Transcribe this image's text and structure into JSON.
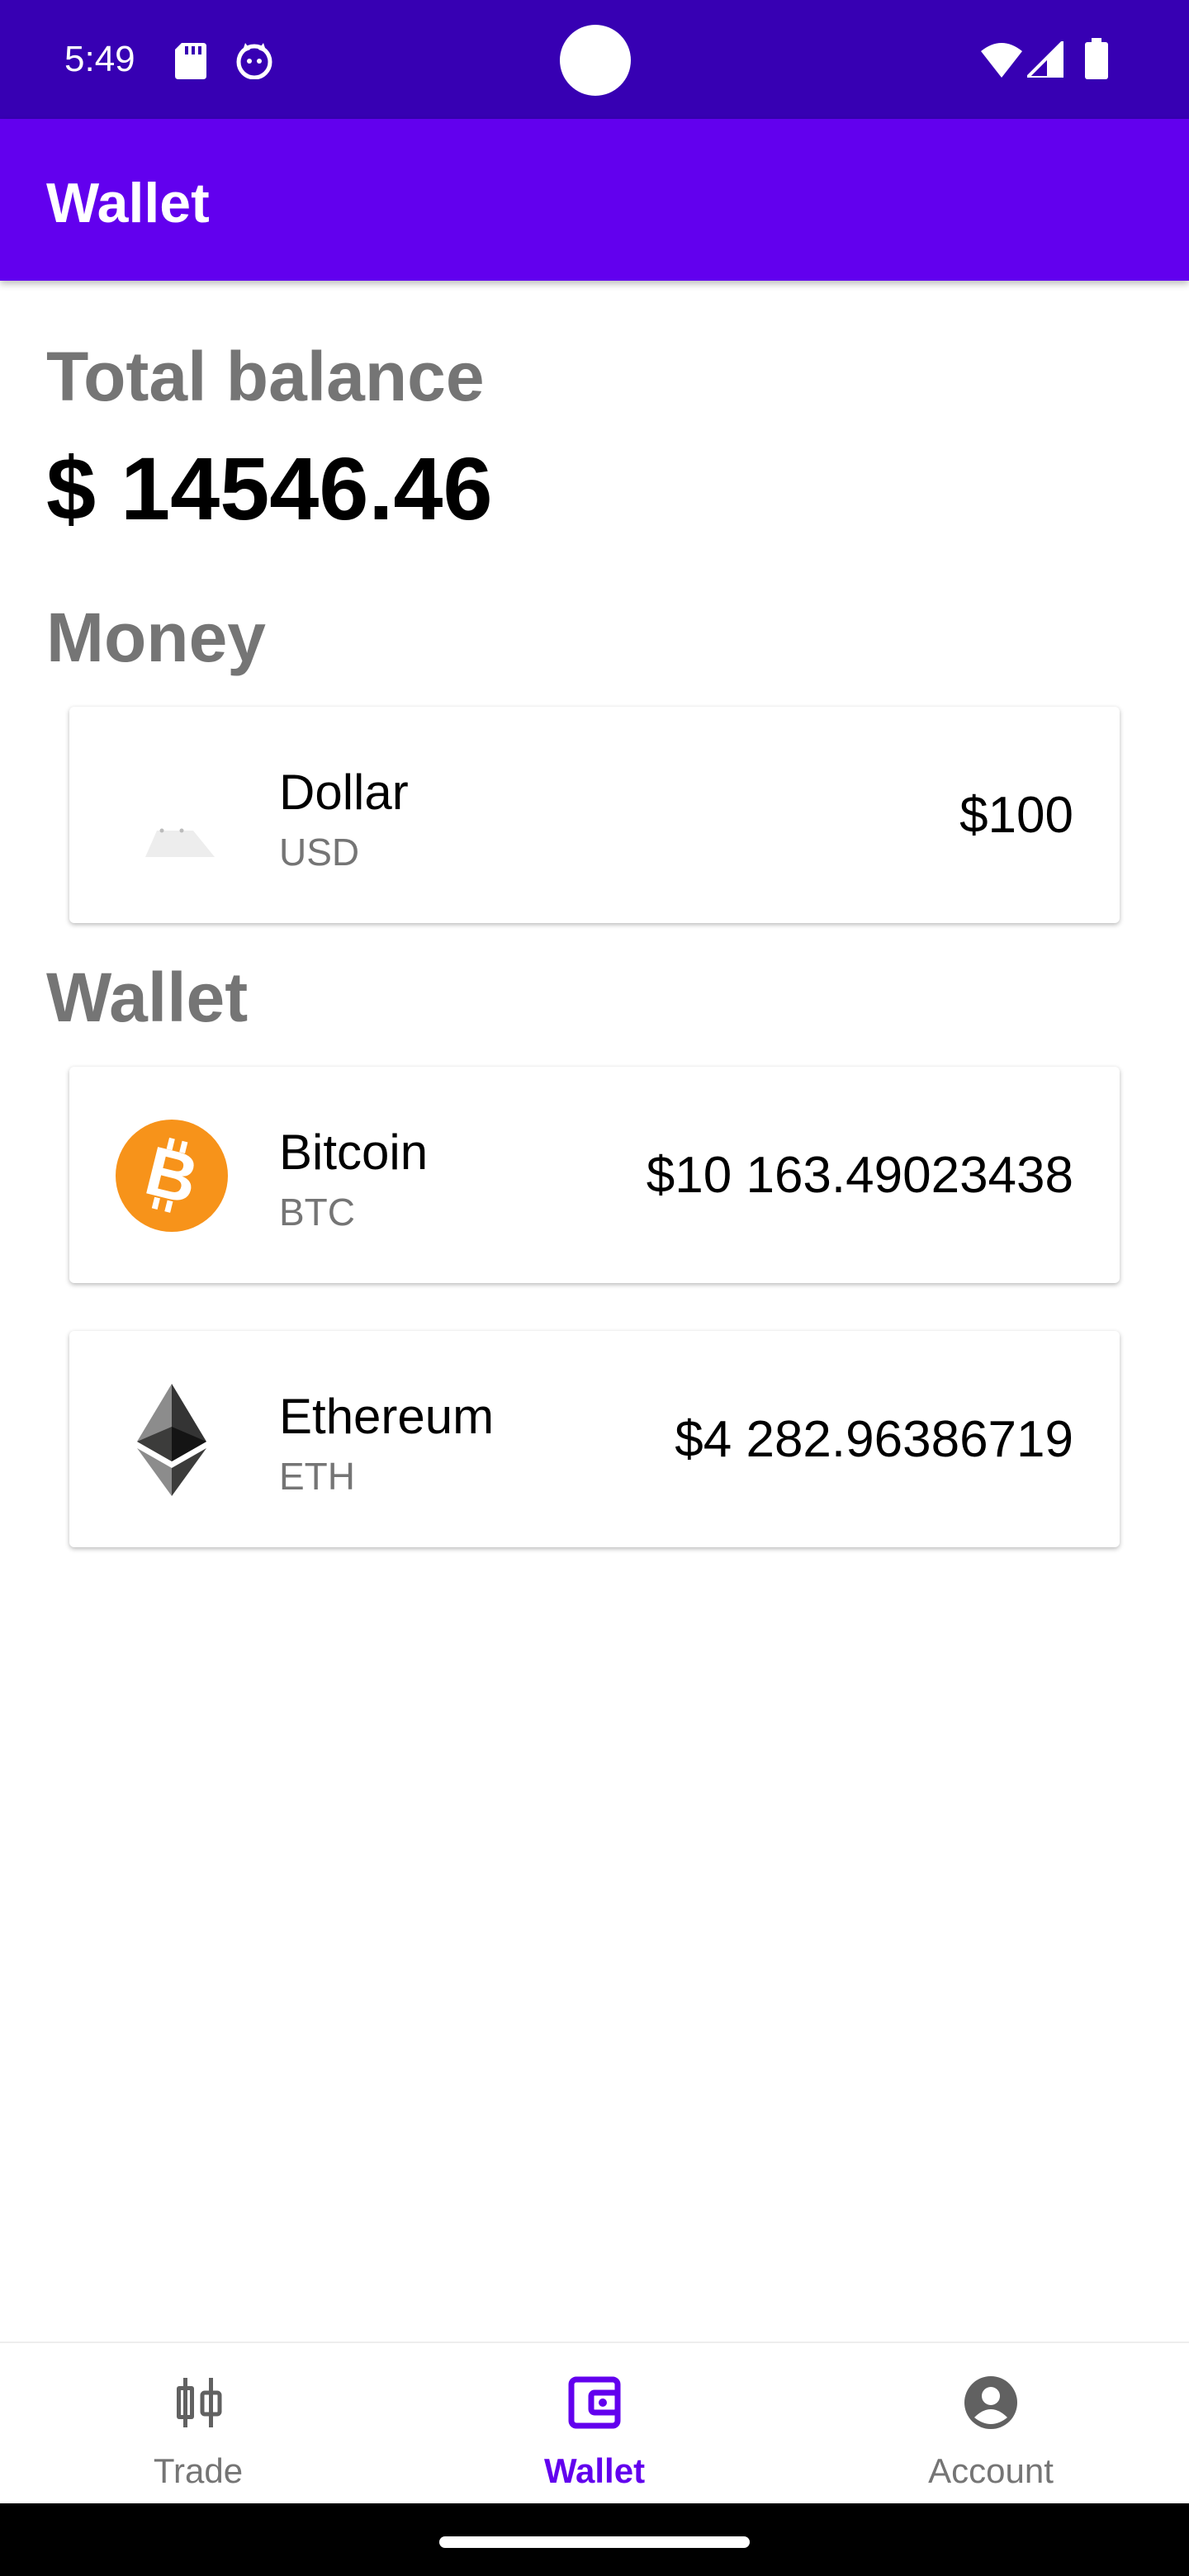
{
  "status_bar": {
    "time": "5:49",
    "icons": [
      "sd-card-icon",
      "cat-notification-icon",
      "wifi-icon",
      "signal-icon",
      "battery-icon"
    ]
  },
  "app_bar": {
    "title": "Wallet"
  },
  "total": {
    "label": "Total balance",
    "value": "$ 14546.46"
  },
  "money": {
    "label": "Money",
    "items": [
      {
        "name": "Dollar",
        "code": "USD",
        "amount": "$100",
        "icon": "dollar-icon"
      }
    ]
  },
  "wallet": {
    "label": "Wallet",
    "items": [
      {
        "name": "Bitcoin",
        "code": "BTC",
        "amount": "$10 163.49023438",
        "icon": "bitcoin-icon",
        "color": "#F7931A"
      },
      {
        "name": "Ethereum",
        "code": "ETH",
        "amount": "$4 282.96386719",
        "icon": "ethereum-icon",
        "color": "#343434"
      }
    ]
  },
  "bottom_nav": {
    "items": [
      {
        "label": "Trade",
        "icon": "candlestick-icon",
        "active": false
      },
      {
        "label": "Wallet",
        "icon": "wallet-icon",
        "active": true
      },
      {
        "label": "Account",
        "icon": "account-icon",
        "active": false
      }
    ]
  },
  "colors": {
    "primary": "#6200EE",
    "primary_dark": "#3700B3",
    "secondary_text": "#757575"
  }
}
